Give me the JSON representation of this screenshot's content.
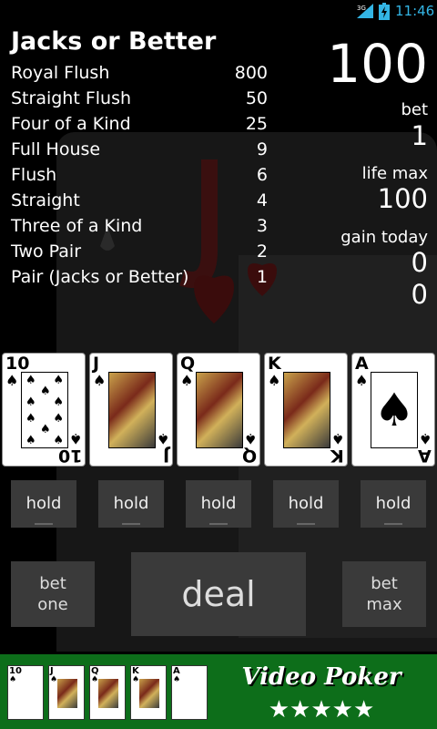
{
  "status_bar": {
    "network": "3G",
    "time": "11:46"
  },
  "paytable": {
    "title": "Jacks or Better",
    "rows": [
      {
        "name": "Royal Flush",
        "payout": "800"
      },
      {
        "name": "Straight Flush",
        "payout": "50"
      },
      {
        "name": "Four of a Kind",
        "payout": "25"
      },
      {
        "name": "Full House",
        "payout": "9"
      },
      {
        "name": "Flush",
        "payout": "6"
      },
      {
        "name": "Straight",
        "payout": "4"
      },
      {
        "name": "Three of a Kind",
        "payout": "3"
      },
      {
        "name": "Two Pair",
        "payout": "2"
      },
      {
        "name": "Pair (Jacks or Better)",
        "payout": "1"
      }
    ]
  },
  "stats": {
    "credits": "100",
    "bet_label": "bet",
    "bet_value": "1",
    "life_max_label": "life max",
    "life_max_value": "100",
    "gain_today_label": "gain today",
    "gain_today_value": "0",
    "extra_value": "0"
  },
  "hand": [
    {
      "rank": "10",
      "suit": "♠"
    },
    {
      "rank": "J",
      "suit": "♠"
    },
    {
      "rank": "Q",
      "suit": "♠"
    },
    {
      "rank": "K",
      "suit": "♠"
    },
    {
      "rank": "A",
      "suit": "♠"
    }
  ],
  "hold_buttons": [
    "hold",
    "hold",
    "hold",
    "hold",
    "hold"
  ],
  "actions": {
    "bet_one_line1": "bet",
    "bet_one_line2": "one",
    "deal": "deal",
    "bet_max_line1": "bet",
    "bet_max_line2": "max"
  },
  "banner": {
    "title": "Video Poker",
    "stars": "★★★★★",
    "mini_cards": [
      "10",
      "J",
      "Q",
      "K",
      "A"
    ]
  },
  "colors": {
    "felt_green": "#0d6e1a",
    "button_gray": "#3a3a3a",
    "status_blue": "#33b5e5"
  }
}
